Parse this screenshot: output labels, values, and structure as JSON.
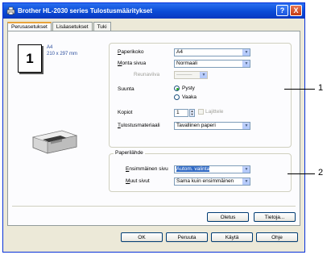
{
  "window": {
    "title": "Brother HL-2030 series Tulostusmääritykset",
    "help_glyph": "?",
    "close_glyph": "X"
  },
  "tabs": [
    {
      "label": "Perusasetukset",
      "active": true
    },
    {
      "label": "Lisäasetukset",
      "active": false
    },
    {
      "label": "Tuki",
      "active": false
    }
  ],
  "preview": {
    "pages_number": "1",
    "paper_name": "A4",
    "paper_dims": "210 x 297 mm"
  },
  "basic_settings": {
    "paper_size": {
      "label": "Paperikoko",
      "value": "A4"
    },
    "multiple_page": {
      "label": "Monta sivua",
      "value": "Normaali"
    },
    "border_line": {
      "label": "Reunaviiva",
      "value": "———"
    },
    "orientation": {
      "label": "Suunta",
      "options": [
        "Pysty",
        "Vaaka"
      ],
      "selected": "Pysty"
    },
    "copies": {
      "label": "Kopiot",
      "value": "1",
      "collate_label": "Lajittele"
    },
    "media_type": {
      "label": "Tulostusmateriaali",
      "value": "Tavallinen paperi"
    }
  },
  "paper_source": {
    "legend": "Paperilähde",
    "first_page": {
      "label": "Ensimmäinen sivu",
      "value": "Autom. valinta"
    },
    "other_pages": {
      "label": "Muut sivut",
      "value": "Sama kuin ensimmäinen"
    }
  },
  "panel_buttons": {
    "default": "Oletus",
    "about": "Tietoja..."
  },
  "dialog_buttons": {
    "ok": "OK",
    "cancel": "Peruuta",
    "apply": "Käytä",
    "help": "Ohje"
  },
  "callouts": [
    "1",
    "2"
  ],
  "icons": {
    "combo_arrow": "▼",
    "spin_up": "▲",
    "spin_down": "▼"
  },
  "colors": {
    "titlebar": "#0a4ad6",
    "selection": "#316ac5",
    "dialog_bg": "#ece9d8"
  }
}
